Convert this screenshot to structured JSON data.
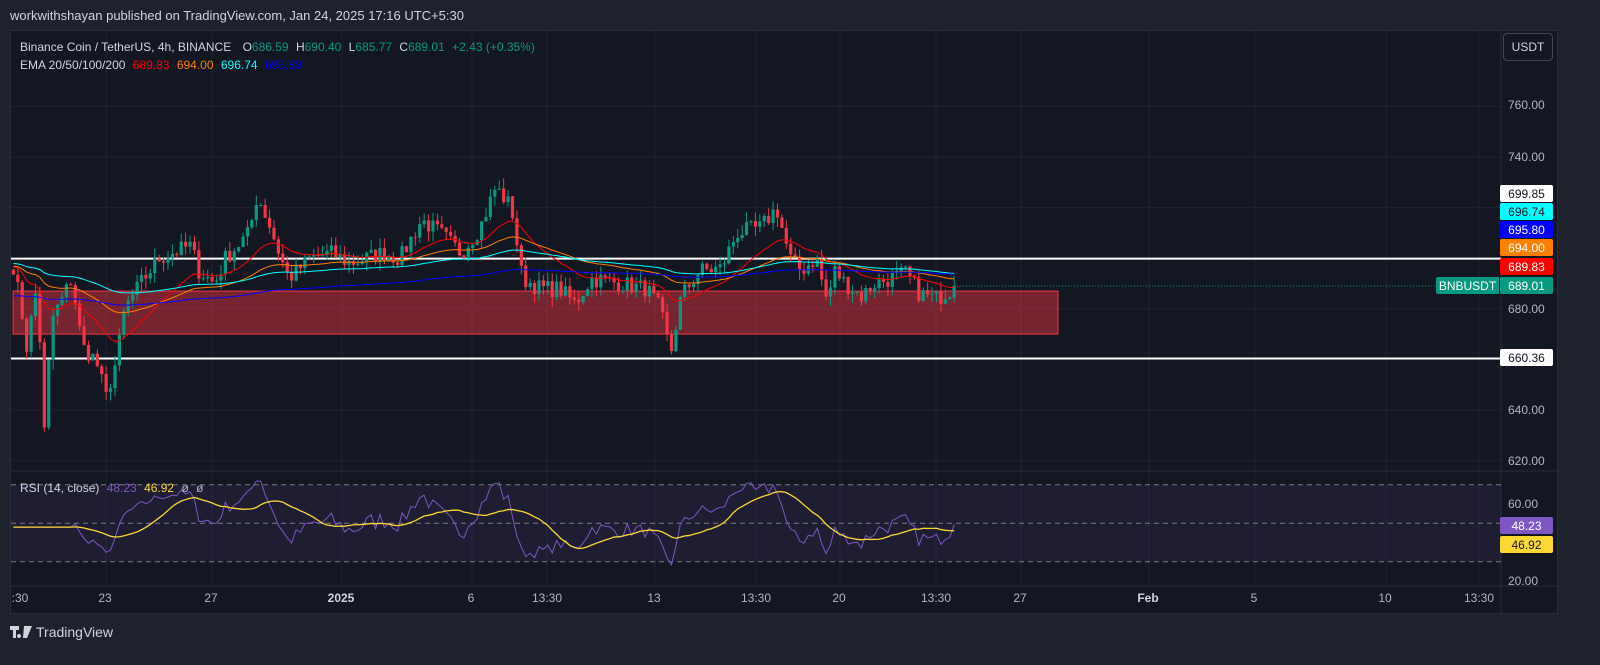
{
  "published": "workwithshayan published on TradingView.com, Jan 24, 2025 17:16 UTC+5:30",
  "legend": {
    "symbol": "Binance Coin / TetherUS, 4h, BINANCE",
    "o_label": "O",
    "o": "686.59",
    "h_label": "H",
    "h": "690.40",
    "l_label": "L",
    "l": "685.77",
    "c_label": "C",
    "c": "689.01",
    "change": "+2.43 (+0.35%)"
  },
  "ema_legend": {
    "label": "EMA 20/50/100/200",
    "ema20": "689.83",
    "ema50": "694.00",
    "ema100": "696.74",
    "ema200": "695.80"
  },
  "rsi_legend": {
    "label": "RSI (14, close)",
    "rsi": "48.23",
    "ma": "46.92",
    "x1": "ø",
    "x2": "ø"
  },
  "currency_button": "USDT",
  "price_tags": {
    "line_high": "699.85",
    "ema100": "696.74",
    "ema200": "695.80",
    "ema50": "694.00",
    "ema20": "689.83",
    "symbol": "BNBUSDT",
    "last": "689.01",
    "line_low": "660.36"
  },
  "rsi_tags": {
    "rsi": "48.23",
    "ma": "46.92"
  },
  "price_axis": [
    "760.00",
    "740.00",
    "700.00",
    "680.00",
    "640.00",
    "620.00"
  ],
  "rsi_axis": [
    "60.00",
    "20.00"
  ],
  "time_axis": [
    ":30",
    "23",
    "27",
    "2025",
    "6",
    "13:30",
    "13",
    "13:30",
    "20",
    "13:30",
    "27",
    "Feb",
    "5",
    "10",
    "13:30"
  ],
  "brand": "TradingView",
  "colors": {
    "up": "#089981",
    "down": "#f23645",
    "ema20": "#ff0000",
    "ema50": "#ff7f00",
    "ema100": "#00ffff",
    "ema200": "#0000ff",
    "rsi": "#7e57c2",
    "rsi_ma": "#fdd835",
    "zone": "#f23645"
  },
  "chart_data": {
    "type": "candlestick",
    "timeframe": "4h",
    "price_range": [
      610,
      775
    ],
    "levels": [
      699.85,
      660.36
    ],
    "zone": [
      670,
      687
    ],
    "rsi_range": [
      15,
      75
    ],
    "rsi_bands": [
      70,
      50,
      30
    ],
    "close_path_days_since_jan1": [
      [
        -12.4,
        697
      ],
      [
        -12.1,
        680
      ],
      [
        -11.9,
        665
      ],
      [
        -11.5,
        690
      ],
      [
        -11.2,
        624
      ],
      [
        -11,
        675
      ],
      [
        -10.6,
        683
      ],
      [
        -10.2,
        692
      ],
      [
        -9.8,
        665
      ],
      [
        -9.3,
        660
      ],
      [
        -8.9,
        645
      ],
      [
        -8.5,
        660
      ],
      [
        -8.2,
        680
      ],
      [
        -7.6,
        690
      ],
      [
        -6.9,
        700
      ],
      [
        -5.7,
        705
      ],
      [
        -5.4,
        695
      ],
      [
        -4.8,
        690
      ],
      [
        -4.4,
        700
      ],
      [
        -3.5,
        710
      ],
      [
        -3.2,
        725
      ],
      [
        -2.8,
        715
      ],
      [
        -2.3,
        700
      ],
      [
        -2,
        692
      ],
      [
        -1.2,
        700
      ],
      [
        -0.4,
        702
      ],
      [
        0.3,
        698
      ],
      [
        1.5,
        702
      ],
      [
        2.2,
        700
      ],
      [
        3,
        715
      ],
      [
        3.7,
        710
      ],
      [
        4.5,
        702
      ],
      [
        5.2,
        712
      ],
      [
        5.8,
        728
      ],
      [
        6.4,
        720
      ],
      [
        6.8,
        692
      ],
      [
        7.5,
        688
      ],
      [
        8.2,
        688
      ],
      [
        8.8,
        682
      ],
      [
        9.4,
        692
      ],
      [
        10.5,
        690
      ],
      [
        11.5,
        688
      ],
      [
        12,
        680
      ],
      [
        12.4,
        662
      ],
      [
        12.8,
        685
      ],
      [
        13.5,
        695
      ],
      [
        14.3,
        696
      ],
      [
        14.9,
        710
      ],
      [
        15.8,
        712
      ],
      [
        16.4,
        720
      ],
      [
        16.9,
        700
      ],
      [
        17.3,
        695
      ],
      [
        17.9,
        700
      ],
      [
        18.3,
        683
      ],
      [
        18.6,
        695
      ],
      [
        19,
        690
      ],
      [
        19.6,
        685
      ],
      [
        20.1,
        690
      ],
      [
        20.7,
        692
      ],
      [
        21.3,
        694
      ],
      [
        21.8,
        686
      ],
      [
        22.4,
        684
      ],
      [
        23.2,
        689
      ]
    ]
  }
}
